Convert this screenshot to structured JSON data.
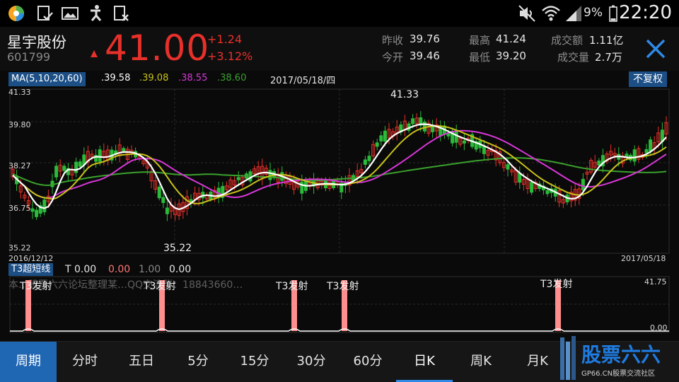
{
  "status_bar": {
    "signal_text": "9%",
    "time": "22:20",
    "left_icons": [
      "app-icon",
      "note-check-icon",
      "gallery-icon",
      "accessibility-icon",
      "doc-x-icon"
    ],
    "right_icons": [
      "mute-icon",
      "wifi-icon",
      "cellular-signal-icon"
    ]
  },
  "quote": {
    "name": "星宇股份",
    "code": "601799",
    "price": "41.00",
    "change": "+1.24",
    "change_pct": "+3.12%",
    "stats": [
      {
        "label": "昨收",
        "value": "39.76"
      },
      {
        "label": "今开",
        "value": "39.46"
      },
      {
        "label": "最高",
        "value": "41.24"
      },
      {
        "label": "最低",
        "value": "39.20"
      },
      {
        "label": "成交额",
        "value": "1.11亿"
      },
      {
        "label": "成交量",
        "value": "2.7万"
      }
    ]
  },
  "ma_legend": {
    "label": "MA(5,10,20,60)",
    "values": [
      ".39.58",
      ".39.08",
      ".38.55",
      ".38.60"
    ],
    "date": "2017/05/18/四",
    "adjust_button": "不复权"
  },
  "kline": {
    "y_ticks": [
      "41.33",
      "39.80",
      "38.27",
      "36.75",
      "35.22"
    ],
    "start_date": "2016/12/12",
    "end_date": "2017/05/18",
    "high_label": "41.33",
    "low_label": "35.22"
  },
  "t3": {
    "label": "T3超短线",
    "values": [
      "T 0.00",
      "0.00",
      "1.00",
      "0.00"
    ],
    "y_max": "41.75",
    "y_min": "0.00",
    "signal_text": "T3发射",
    "watermark": "本…股票六六论坛整理某…QQ交流群：18843660…"
  },
  "tabs": [
    "周期",
    "分时",
    "五日",
    "5分",
    "15分",
    "30分",
    "60分",
    "日K",
    "周K",
    "月K"
  ],
  "logo": {
    "text": "股票六六",
    "sub": "GP66.CN股票交流社区"
  },
  "colors": {
    "up": "#e8302a",
    "down": "#2bbb3a",
    "ma5": "#ffffff",
    "ma10": "#c8c21a",
    "ma20": "#d837d8",
    "ma60": "#3aa12c",
    "accent": "#1f66b3"
  }
}
